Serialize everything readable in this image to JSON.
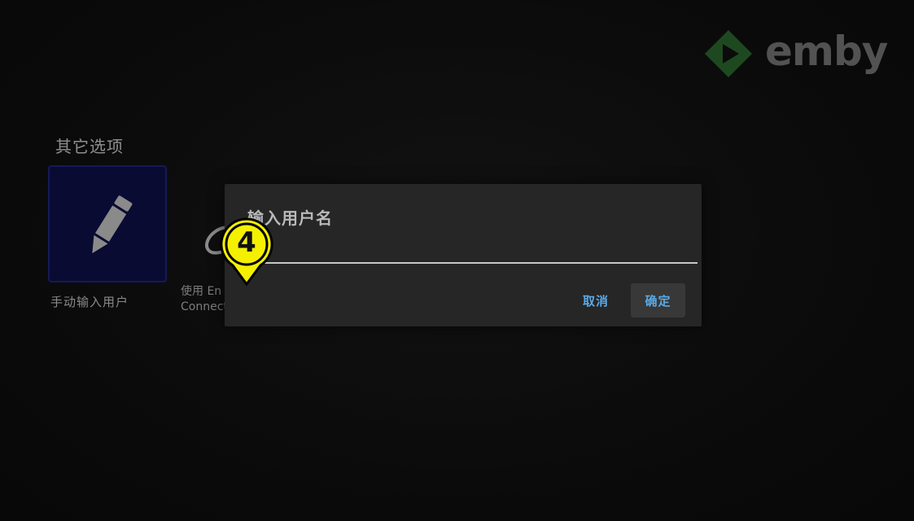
{
  "brand": {
    "name": "emby",
    "colors": {
      "mark_green": "#2e7d32",
      "mark_dark": "#1b5e20",
      "word": "#8d8d8d"
    }
  },
  "section": {
    "title": "其它选项"
  },
  "options": [
    {
      "label": "手动输入用户",
      "icon": "pencil-icon"
    },
    {
      "label_line1": "使用 En",
      "label_line2": "Connect",
      "icon": "emby-connect-icon"
    }
  ],
  "dialog": {
    "title": "输入用户名",
    "input_value": "",
    "cancel_label": "取消",
    "ok_label": "确定"
  },
  "annotation": {
    "step": "4",
    "color": "#f5f000"
  },
  "colors": {
    "background": "#0b0b0b",
    "dialog_bg": "#262626",
    "accent": "#5aa9e6",
    "selected_card": "#0a0b33"
  }
}
